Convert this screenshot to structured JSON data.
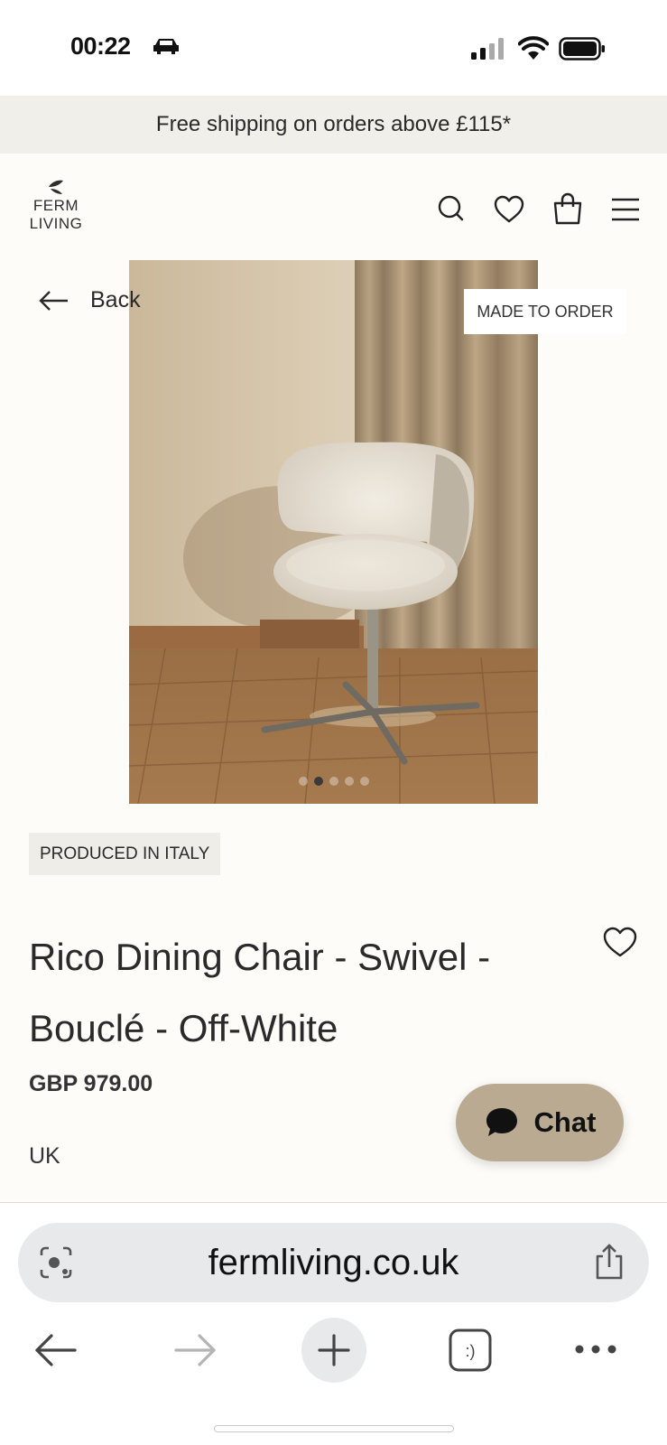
{
  "status_bar": {
    "time": "00:22",
    "icons": [
      "car-icon",
      "signal-icon",
      "wifi-icon",
      "battery-icon"
    ]
  },
  "promo": {
    "text": "Free shipping on orders above £115*"
  },
  "header": {
    "logo_line1": "FERM",
    "logo_line2": "LIVING",
    "icons": [
      "search-icon",
      "heart-icon",
      "bag-icon",
      "menu-icon"
    ]
  },
  "product": {
    "back_label": "Back",
    "badge": "MADE TO ORDER",
    "gallery_dot_count": 5,
    "gallery_active_index": 1,
    "origin": "PRODUCED IN ITALY",
    "title": "Rico Dining Chair - Swivel - Bouclé - Off-White",
    "price": "GBP 979.00",
    "country": "UK"
  },
  "chat": {
    "label": "Chat"
  },
  "browser": {
    "url": "fermliving.co.uk",
    "toolbar_icons": [
      "back-arrow-icon",
      "forward-arrow-icon",
      "plus-icon",
      "tabs-icon",
      "more-icon"
    ],
    "tabs_glyph": ":)"
  },
  "colors": {
    "page_bg": "#fdfcf8",
    "promo_bg": "#f1efea",
    "chat_bg": "#b9aa91",
    "url_bar_bg": "#e8e9eb"
  }
}
